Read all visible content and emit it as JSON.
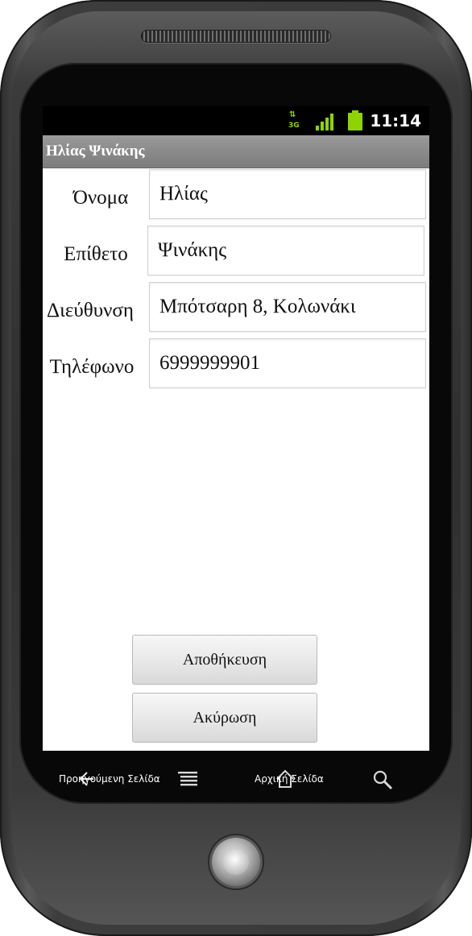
{
  "status_bar": {
    "network": "3G",
    "time": "11:14",
    "icons": [
      "data-arrows-icon",
      "signal-icon",
      "battery-icon"
    ]
  },
  "title_bar": {
    "title": "Ηλίας Ψινάκης"
  },
  "form": {
    "fields": [
      {
        "label": "Όνομα",
        "value": "Ηλίας"
      },
      {
        "label": "Επίθετο",
        "value": "Ψινάκης"
      },
      {
        "label": "Διεύθυνση",
        "value": "Μπότσαρη 8, Κολωνάκι"
      },
      {
        "label": "Τηλέφωνο",
        "value": "6999999901"
      }
    ]
  },
  "buttons": {
    "save": "Αποθήκευση",
    "cancel": "Ακύρωση"
  },
  "soft_keys": {
    "back_label": "Προηγούμενη Σελίδα",
    "home_label": "Αρχική Σελίδα",
    "icons": [
      "back-icon",
      "menu-icon",
      "home-icon",
      "search-icon"
    ]
  },
  "colors": {
    "accent": "#8fd400",
    "title_bar": "#8a8a8a",
    "screen_bg": "#ffffff"
  }
}
